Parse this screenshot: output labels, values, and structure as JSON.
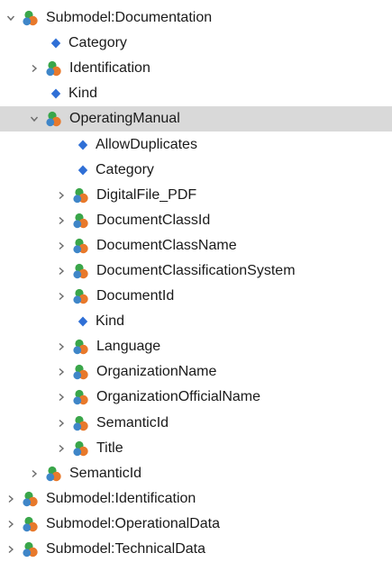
{
  "tree": {
    "rows": [
      {
        "label": "Submodel:Documentation",
        "level": 0,
        "kind": "collection",
        "toggle": "expanded"
      },
      {
        "label": "Category",
        "level": 1,
        "kind": "property",
        "toggle": "none"
      },
      {
        "label": "Identification",
        "level": 1,
        "kind": "collection",
        "toggle": "collapsed"
      },
      {
        "label": "Kind",
        "level": 1,
        "kind": "property",
        "toggle": "none"
      },
      {
        "label": "OperatingManual",
        "level": 1,
        "kind": "collection",
        "toggle": "expanded",
        "selected": true
      },
      {
        "label": "AllowDuplicates",
        "level": 2,
        "kind": "property",
        "toggle": "none"
      },
      {
        "label": "Category",
        "level": 2,
        "kind": "property",
        "toggle": "none"
      },
      {
        "label": "DigitalFile_PDF",
        "level": 2,
        "kind": "collection",
        "toggle": "collapsed"
      },
      {
        "label": "DocumentClassId",
        "level": 2,
        "kind": "collection",
        "toggle": "collapsed"
      },
      {
        "label": "DocumentClassName",
        "level": 2,
        "kind": "collection",
        "toggle": "collapsed"
      },
      {
        "label": "DocumentClassificationSystem",
        "level": 2,
        "kind": "collection",
        "toggle": "collapsed"
      },
      {
        "label": "DocumentId",
        "level": 2,
        "kind": "collection",
        "toggle": "collapsed"
      },
      {
        "label": "Kind",
        "level": 2,
        "kind": "property",
        "toggle": "none"
      },
      {
        "label": "Language",
        "level": 2,
        "kind": "collection",
        "toggle": "collapsed"
      },
      {
        "label": "OrganizationName",
        "level": 2,
        "kind": "collection",
        "toggle": "collapsed"
      },
      {
        "label": "OrganizationOfficialName",
        "level": 2,
        "kind": "collection",
        "toggle": "collapsed"
      },
      {
        "label": "SemanticId",
        "level": 2,
        "kind": "collection",
        "toggle": "collapsed"
      },
      {
        "label": "Title",
        "level": 2,
        "kind": "collection",
        "toggle": "collapsed"
      },
      {
        "label": "SemanticId",
        "level": 1,
        "kind": "collection",
        "toggle": "collapsed"
      },
      {
        "label": "Submodel:Identification",
        "level": 0,
        "kind": "collection",
        "toggle": "collapsed"
      },
      {
        "label": "Submodel:OperationalData",
        "level": 0,
        "kind": "collection",
        "toggle": "collapsed"
      },
      {
        "label": "Submodel:TechnicalData",
        "level": 0,
        "kind": "collection",
        "toggle": "collapsed"
      }
    ]
  },
  "icons": {
    "collection": "submodel-element-collection-icon",
    "property": "property-diamond-icon",
    "expanded": "chevron-down-icon",
    "collapsed": "chevron-right-icon"
  },
  "colors": {
    "selected_row": "#d9d9d9",
    "property_diamond": "#2f6fd6",
    "collection_green": "#3aa64a",
    "collection_orange": "#e8792b",
    "collection_blue": "#3f86c8",
    "chevron": "#6b6b6b"
  }
}
